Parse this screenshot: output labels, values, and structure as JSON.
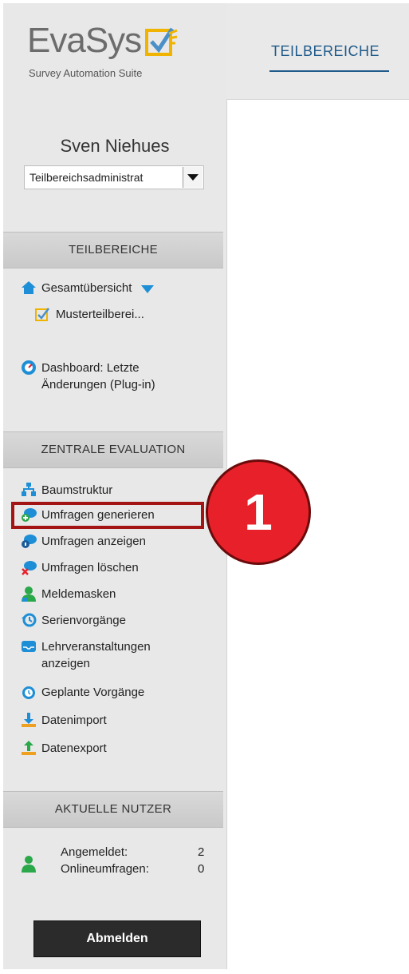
{
  "logo": {
    "brand": "EvaSys",
    "tagline": "Survey Automation Suite"
  },
  "header": {
    "tab_label": "TEILBEREICHE"
  },
  "user": {
    "name": "Sven Niehues",
    "role_selected": "Teilbereichsadministrat"
  },
  "teilbereiche": {
    "header": "TEILBEREICHE",
    "overview": "Gesamtübersicht",
    "subitem": "Musterteilberei...",
    "dashboard_line1": "Dashboard: Letzte",
    "dashboard_line2": "Änderungen (Plug-in)"
  },
  "zentrale": {
    "header": "ZENTRALE EVALUATION",
    "items": [
      {
        "label": "Baumstruktur",
        "icon": "tree-icon"
      },
      {
        "label": "Umfragen generieren",
        "icon": "generate-survey-icon"
      },
      {
        "label": "Umfragen anzeigen",
        "icon": "show-survey-icon"
      },
      {
        "label": "Umfragen löschen",
        "icon": "delete-survey-icon"
      },
      {
        "label": "Meldemasken",
        "icon": "person-icon"
      },
      {
        "label": "Serienvorgänge",
        "icon": "history-icon"
      },
      {
        "label_line1": "Lehrveranstaltungen",
        "label_line2": "anzeigen",
        "icon": "inbox-icon"
      },
      {
        "label": "Geplante Vorgänge",
        "icon": "alarm-icon"
      },
      {
        "label": "Datenimport",
        "icon": "download-icon"
      },
      {
        "label": "Datenexport",
        "icon": "upload-icon"
      }
    ]
  },
  "annotation": {
    "number": "1",
    "color": "#e8202a"
  },
  "aktuelle_nutzer": {
    "header": "AKTUELLE NUTZER",
    "logged_in_label": "Angemeldet:",
    "logged_in_value": "2",
    "online_label": "Onlineumfragen:",
    "online_value": "0"
  },
  "logout_label": "Abmelden",
  "colors": {
    "accent_blue": "#1f5a8a",
    "highlight_red": "#a31515",
    "sidebar_bg": "#e8e8e8"
  }
}
